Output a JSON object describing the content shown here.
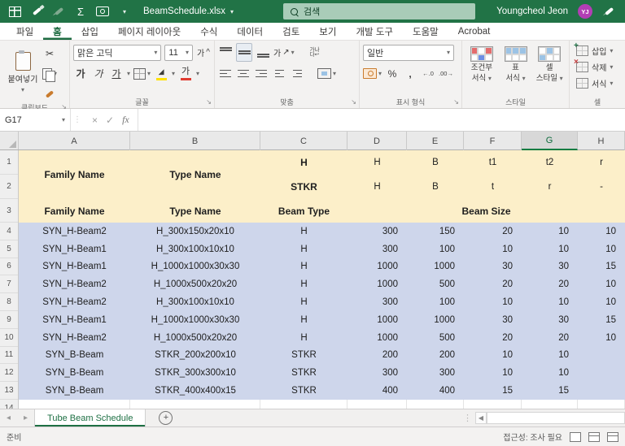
{
  "colors": {
    "accent_green": "#217346",
    "header_fill": "#fcefc9",
    "data_fill": "#ced6eb",
    "avatar_purple": "#b23eb5"
  },
  "titlebar": {
    "title": "BeamSchedule.xlsx",
    "search_label": "검색",
    "user_name": "Youngcheol Jeon",
    "user_initials": "YJ"
  },
  "menu": {
    "tabs": [
      "파일",
      "홈",
      "삽입",
      "페이지 레이아웃",
      "수식",
      "데이터",
      "검토",
      "보기",
      "개발 도구",
      "도움말",
      "Acrobat"
    ],
    "active_tab": "홈"
  },
  "ribbon": {
    "clipboard": {
      "group_label": "클립보드",
      "paste_label": "붙여넣기"
    },
    "font": {
      "group_label": "글꼴",
      "font_name": "맑은 고딕",
      "font_size": "11",
      "bold": "가",
      "italic": "가",
      "underline": "가",
      "font_color": "가",
      "grow": "가",
      "shrink": "가"
    },
    "alignment": {
      "group_label": "맞춤",
      "orientation": "가",
      "wrap_line1": "가나",
      "wrap_line2": "다"
    },
    "number": {
      "group_label": "표시 형식",
      "format_value": "일반",
      "percent": "%",
      "comma": ",",
      "inc_decimal": "←.0",
      "dec_decimal": ".00→"
    },
    "styles": {
      "group_label": "스타일",
      "buttons": [
        {
          "line1": "조건부",
          "line2": "서식"
        },
        {
          "line1": "표",
          "line2": "서식"
        },
        {
          "line1": "셀",
          "line2": "스타일"
        }
      ]
    },
    "cells": {
      "group_label": "셀",
      "buttons": [
        "삽입",
        "삭제",
        "서식"
      ]
    }
  },
  "formula_bar": {
    "name_box": "G17",
    "fx": "fx"
  },
  "sheet": {
    "column_headers": [
      "A",
      "B",
      "C",
      "D",
      "E",
      "F",
      "G",
      "H"
    ],
    "selected_column": "G",
    "header": {
      "family_name": "Family Name",
      "type_name": "Type Name",
      "row1": {
        "C": "H",
        "D": "H",
        "E": "B",
        "F": "t1",
        "G": "t2",
        "H": "r"
      },
      "row2": {
        "C": "STKR",
        "D": "H",
        "E": "B",
        "F": "t",
        "G": "r",
        "H": "-"
      },
      "row3": {
        "A": "Family Name",
        "B": "Type Name",
        "C": "Beam Type",
        "DH": "Beam Size"
      }
    },
    "rows": [
      [
        "SYN_H-Beam2",
        "H_300x150x20x10",
        "H",
        "300",
        "150",
        "20",
        "10",
        "10"
      ],
      [
        "SYN_H-Beam1",
        "H_300x100x10x10",
        "H",
        "300",
        "100",
        "10",
        "10",
        "10"
      ],
      [
        "SYN_H-Beam1",
        "H_1000x1000x30x30",
        "H",
        "1000",
        "1000",
        "30",
        "30",
        "15"
      ],
      [
        "SYN_H-Beam2",
        "H_1000x500x20x20",
        "H",
        "1000",
        "500",
        "20",
        "20",
        "10"
      ],
      [
        "SYN_H-Beam2",
        "H_300x100x10x10",
        "H",
        "300",
        "100",
        "10",
        "10",
        "10"
      ],
      [
        "SYN_H-Beam1",
        "H_1000x1000x30x30",
        "H",
        "1000",
        "1000",
        "30",
        "30",
        "15"
      ],
      [
        "SYN_H-Beam2",
        "H_1000x500x20x20",
        "H",
        "1000",
        "500",
        "20",
        "20",
        "10"
      ],
      [
        "SYN_B-Beam",
        "STKR_200x200x10",
        "STKR",
        "200",
        "200",
        "10",
        "10",
        ""
      ],
      [
        "SYN_B-Beam",
        "STKR_300x300x10",
        "STKR",
        "300",
        "300",
        "10",
        "10",
        ""
      ],
      [
        "SYN_B-Beam",
        "STKR_400x400x15",
        "STKR",
        "400",
        "400",
        "15",
        "15",
        ""
      ]
    ]
  },
  "sheet_tabs": {
    "active_tab": "Tube Beam Schedule"
  },
  "status_bar": {
    "left": "준비",
    "right": "접근성: 조사 필요"
  }
}
